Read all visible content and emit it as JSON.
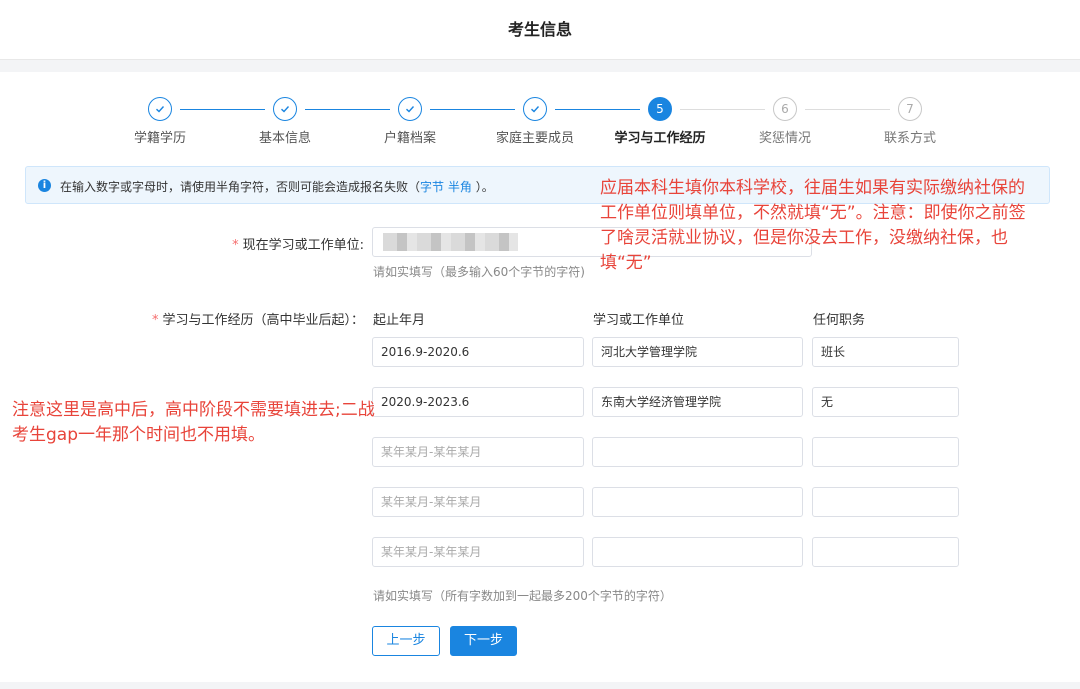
{
  "header": {
    "title": "考生信息"
  },
  "steps": [
    {
      "num": "1",
      "label": "学籍学历",
      "state": "done"
    },
    {
      "num": "2",
      "label": "基本信息",
      "state": "done"
    },
    {
      "num": "3",
      "label": "户籍档案",
      "state": "done"
    },
    {
      "num": "4",
      "label": "家庭主要成员",
      "state": "done"
    },
    {
      "num": "5",
      "label": "学习与工作经历",
      "state": "active"
    },
    {
      "num": "6",
      "label": "奖惩情况",
      "state": "todo"
    },
    {
      "num": "7",
      "label": "联系方式",
      "state": "todo"
    }
  ],
  "alert": {
    "text_before": "在输入数字或字母时，请使用半角字符，否则可能会造成报名失败（",
    "link1": "字节",
    "link2": "半角",
    "text_after": "）。"
  },
  "current_unit": {
    "label": "现在学习或工作单位:",
    "hint": "请如实填写（最多输入60个字节的字符)"
  },
  "history": {
    "label": "学习与工作经历（高中毕业后起）：",
    "columns": [
      "起止年月",
      "学习或工作单位",
      "任何职务"
    ],
    "rows": [
      {
        "period": "2016.9-2020.6",
        "unit": "河北大学管理学院",
        "position": "班长"
      },
      {
        "period": "2020.9-2023.6",
        "unit": "东南大学经济管理学院",
        "position": "无"
      },
      {
        "period": "",
        "unit": "",
        "position": ""
      },
      {
        "period": "",
        "unit": "",
        "position": ""
      },
      {
        "period": "",
        "unit": "",
        "position": ""
      }
    ],
    "period_placeholder": "某年某月-某年某月",
    "hint": "请如实填写（所有字数加到一起最多200个字节的字符）"
  },
  "buttons": {
    "prev": "上一步",
    "next": "下一步"
  },
  "annotations": {
    "top_right": "应届本科生填你本科学校，往届生如果有实际缴纳社保的工作单位则填单位，不然就填“无”。注意：即使你之前签了啥灵活就业协议，但是你没去工作，没缴纳社保，也填“无”",
    "left": "注意这里是高中后，高中阶段不需要填进去;二战考生gap一年那个时间也不用填。"
  },
  "colors": {
    "primary": "#1a85e0",
    "annotation": "#e8443a",
    "required": "#f56c6c"
  }
}
